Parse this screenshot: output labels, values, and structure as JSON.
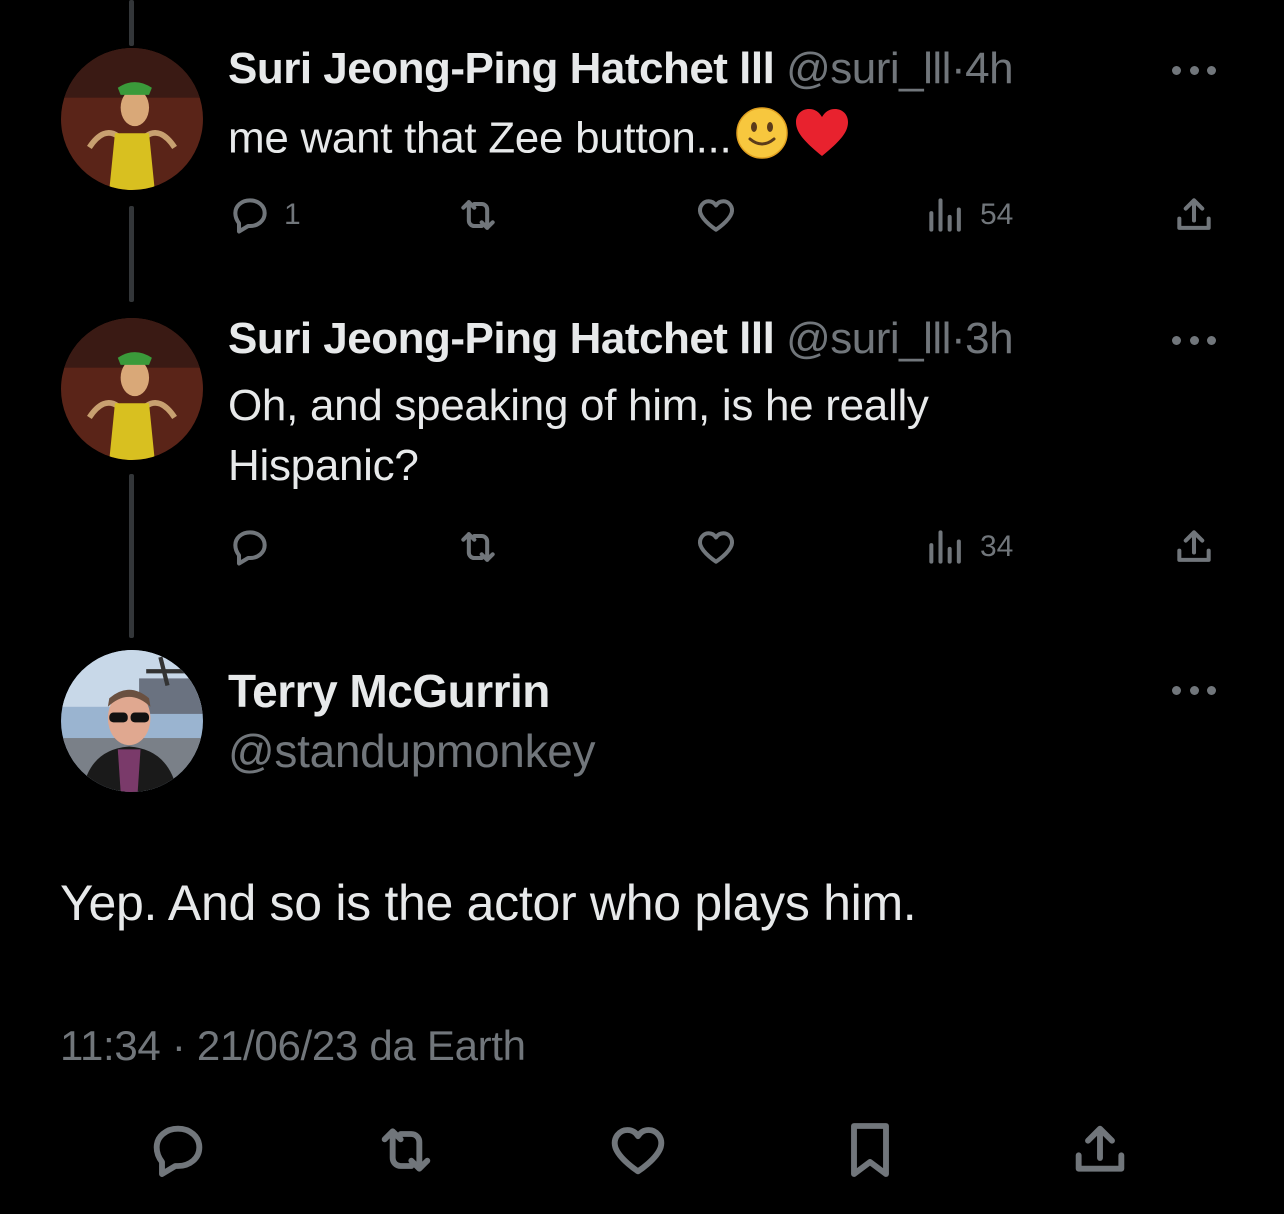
{
  "thread": [
    {
      "author_name": "Suri Jeong-Ping Hatchet lll",
      "handle": "@suri_lll",
      "separator": "·",
      "age": "4h",
      "text": "me want that Zee button...",
      "emojis": [
        "slightly-smiling-face-emoji",
        "red-heart-emoji"
      ],
      "replies": "1",
      "retweets": "",
      "likes": "",
      "views": "54"
    },
    {
      "author_name": "Suri Jeong-Ping Hatchet lll",
      "handle": "@suri_lll",
      "separator": "·",
      "age": "3h",
      "text_line1": "Oh, and speaking of him, is he really",
      "text_line2": "Hispanic?",
      "replies": "",
      "retweets": "",
      "likes": "",
      "views": "34"
    }
  ],
  "main_tweet": {
    "author_name": "Terry McGurrin",
    "handle": "@standupmonkey",
    "text": "Yep. And so is the actor who plays him.",
    "meta": "11:34 · 21/06/23 da Earth"
  },
  "colors": {
    "background": "#000000",
    "primary_text": "#e7e9ea",
    "secondary_text": "#71767b",
    "thread_line": "#333639"
  },
  "icons": [
    "reply-icon",
    "retweet-icon",
    "like-icon",
    "views-icon",
    "share-icon",
    "bookmark-icon",
    "more-icon"
  ]
}
